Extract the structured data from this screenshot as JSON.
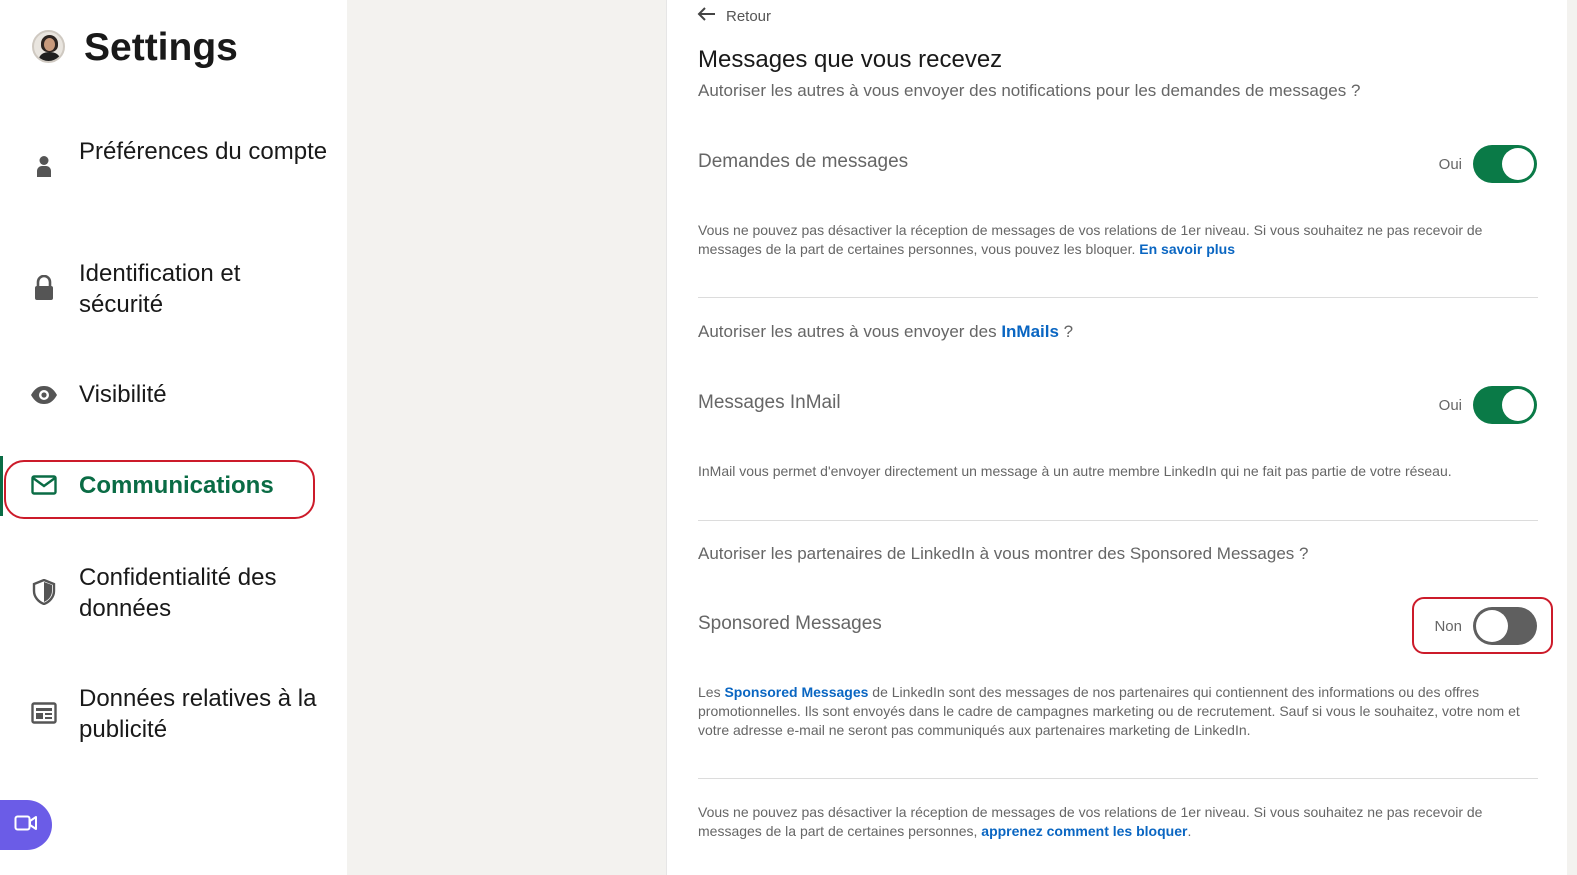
{
  "sidebar": {
    "title": "Settings",
    "items": [
      {
        "label": "Préférences du compte",
        "icon": "person-icon"
      },
      {
        "label": "Identification et sécurité",
        "icon": "lock-icon"
      },
      {
        "label": "Visibilité",
        "icon": "eye-icon"
      },
      {
        "label": "Communications",
        "icon": "envelope-icon",
        "active": true
      },
      {
        "label": "Confidentialité des données",
        "icon": "shield-icon"
      },
      {
        "label": "Données relatives à la publicité",
        "icon": "ad-icon"
      }
    ]
  },
  "main": {
    "back_label": "Retour",
    "title": "Messages que vous recevez",
    "section1": {
      "question": "Autoriser les autres à vous envoyer des notifications pour les demandes de messages ?",
      "label": "Demandes de messages",
      "state": "Oui",
      "desc": "Vous ne pouvez pas désactiver la réception de messages de vos relations de 1er niveau. Si vous souhaitez ne pas recevoir de messages de la part de certaines personnes, vous pouvez les bloquer. ",
      "link": "En savoir plus"
    },
    "section2": {
      "question_prefix": "Autoriser les autres à vous envoyer des ",
      "question_link": "InMails",
      "question_suffix": " ?",
      "label": "Messages InMail",
      "state": "Oui",
      "desc": "InMail vous permet d'envoyer directement un message à un autre membre LinkedIn qui ne fait pas partie de votre réseau."
    },
    "section3": {
      "question": "Autoriser les partenaires de LinkedIn à vous montrer des Sponsored Messages ?",
      "label": "Sponsored Messages",
      "state": "Non",
      "desc_prefix": "Les ",
      "desc_link": "Sponsored Messages",
      "desc_suffix": " de LinkedIn sont des messages de nos partenaires qui contiennent des informations ou des offres promotionnelles. Ils sont envoyés dans le cadre de campagnes marketing ou de recrutement. Sauf si vous le souhaitez, votre nom et votre adresse e-mail ne seront pas communiqués aux partenaires marketing de LinkedIn."
    },
    "footer": {
      "text": "Vous ne pouvez pas désactiver la réception de messages de vos relations de 1er niveau. Si vous souhaitez ne pas recevoir de messages de la part de certaines personnes, ",
      "link": "apprenez comment les bloquer",
      "end": "."
    }
  },
  "colors": {
    "accent_green": "#0a6c45",
    "toggle_on": "#0a7a47",
    "link_blue": "#0a66c2",
    "highlight_red": "#cc1b2a",
    "video_button": "#6b5ce7"
  }
}
